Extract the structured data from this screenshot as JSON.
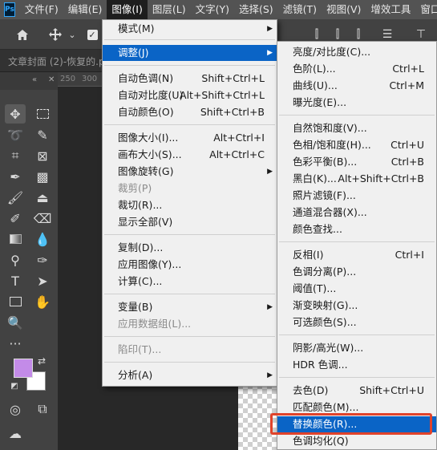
{
  "app_logo": "Ps",
  "menubar": [
    {
      "label": "文件(F)"
    },
    {
      "label": "编辑(E)"
    },
    {
      "label": "图像(I)",
      "active": true
    },
    {
      "label": "图层(L)"
    },
    {
      "label": "文字(Y)"
    },
    {
      "label": "选择(S)"
    },
    {
      "label": "滤镜(T)"
    },
    {
      "label": "视图(V)"
    },
    {
      "label": "增效工具"
    },
    {
      "label": "窗口(W)"
    }
  ],
  "options_bar": {
    "icons": [
      "home-icon",
      "move-tool-icon",
      "chevron-down-icon",
      "checkbox-icon",
      "align-left-icon",
      "align-center-icon",
      "align-right-icon",
      "distribute-icon",
      "align-top-icon"
    ]
  },
  "document_tab": {
    "label": "文章封面 (2)-恢复的.p"
  },
  "ruler": {
    "ticks": [
      "250",
      "300"
    ]
  },
  "tools": [
    "move-tool-icon",
    "marquee-tool-icon",
    "lasso-tool-icon",
    "quick-select-tool-icon",
    "crop-tool-icon",
    "frame-tool-icon",
    "eyedropper-tool-icon",
    "spot-heal-tool-icon",
    "brush-tool-icon",
    "clone-stamp-tool-icon",
    "history-brush-tool-icon",
    "eraser-tool-icon",
    "gradient-tool-icon",
    "blur-tool-icon",
    "dodge-tool-icon",
    "pen-tool-icon",
    "type-tool-icon",
    "path-select-tool-icon",
    "rectangle-tool-icon",
    "hand-tool-icon",
    "zoom-tool-icon",
    "more-tools-icon"
  ],
  "colors": {
    "foreground": "#c38be8",
    "background": "#ffffff",
    "highlight": "#0a64c6",
    "annotation": "#e0432b"
  },
  "image_menu": {
    "items": [
      {
        "label": "模式(M)",
        "shortcut": "",
        "submenu": true
      },
      {
        "label": "调整(J)",
        "shortcut": "",
        "submenu": true,
        "highlight": true
      },
      {
        "label": "自动色调(N)",
        "shortcut": "Shift+Ctrl+L"
      },
      {
        "label": "自动对比度(U)",
        "shortcut": "Alt+Shift+Ctrl+L"
      },
      {
        "label": "自动颜色(O)",
        "shortcut": "Shift+Ctrl+B"
      },
      {
        "label": "图像大小(I)...",
        "shortcut": "Alt+Ctrl+I"
      },
      {
        "label": "画布大小(S)...",
        "shortcut": "Alt+Ctrl+C"
      },
      {
        "label": "图像旋转(G)",
        "shortcut": "",
        "submenu": true
      },
      {
        "label": "裁剪(P)",
        "shortcut": "",
        "disabled": true
      },
      {
        "label": "裁切(R)...",
        "shortcut": ""
      },
      {
        "label": "显示全部(V)",
        "shortcut": ""
      },
      {
        "label": "复制(D)...",
        "shortcut": ""
      },
      {
        "label": "应用图像(Y)...",
        "shortcut": ""
      },
      {
        "label": "计算(C)...",
        "shortcut": ""
      },
      {
        "label": "变量(B)",
        "shortcut": "",
        "submenu": true
      },
      {
        "label": "应用数据组(L)...",
        "shortcut": "",
        "disabled": true
      },
      {
        "label": "陷印(T)...",
        "shortcut": "",
        "disabled": true
      },
      {
        "label": "分析(A)",
        "shortcut": "",
        "submenu": true
      }
    ]
  },
  "adjust_menu": {
    "items": [
      {
        "label": "亮度/对比度(C)...",
        "shortcut": ""
      },
      {
        "label": "色阶(L)...",
        "shortcut": "Ctrl+L"
      },
      {
        "label": "曲线(U)...",
        "shortcut": "Ctrl+M"
      },
      {
        "label": "曝光度(E)...",
        "shortcut": ""
      },
      {
        "label": "自然饱和度(V)...",
        "shortcut": ""
      },
      {
        "label": "色相/饱和度(H)...",
        "shortcut": "Ctrl+U"
      },
      {
        "label": "色彩平衡(B)...",
        "shortcut": "Ctrl+B"
      },
      {
        "label": "黑白(K)...",
        "shortcut": "Alt+Shift+Ctrl+B"
      },
      {
        "label": "照片滤镜(F)...",
        "shortcut": ""
      },
      {
        "label": "通道混合器(X)...",
        "shortcut": ""
      },
      {
        "label": "颜色查找...",
        "shortcut": ""
      },
      {
        "label": "反相(I)",
        "shortcut": "Ctrl+I"
      },
      {
        "label": "色调分离(P)...",
        "shortcut": ""
      },
      {
        "label": "阈值(T)...",
        "shortcut": ""
      },
      {
        "label": "渐变映射(G)...",
        "shortcut": ""
      },
      {
        "label": "可选颜色(S)...",
        "shortcut": ""
      },
      {
        "label": "阴影/高光(W)...",
        "shortcut": ""
      },
      {
        "label": "HDR 色调...",
        "shortcut": ""
      },
      {
        "label": "去色(D)",
        "shortcut": "Shift+Ctrl+U"
      },
      {
        "label": "匹配颜色(M)...",
        "shortcut": ""
      },
      {
        "label": "替换颜色(R)...",
        "shortcut": "",
        "highlight": true
      },
      {
        "label": "色调均化(Q)",
        "shortcut": ""
      }
    ]
  }
}
